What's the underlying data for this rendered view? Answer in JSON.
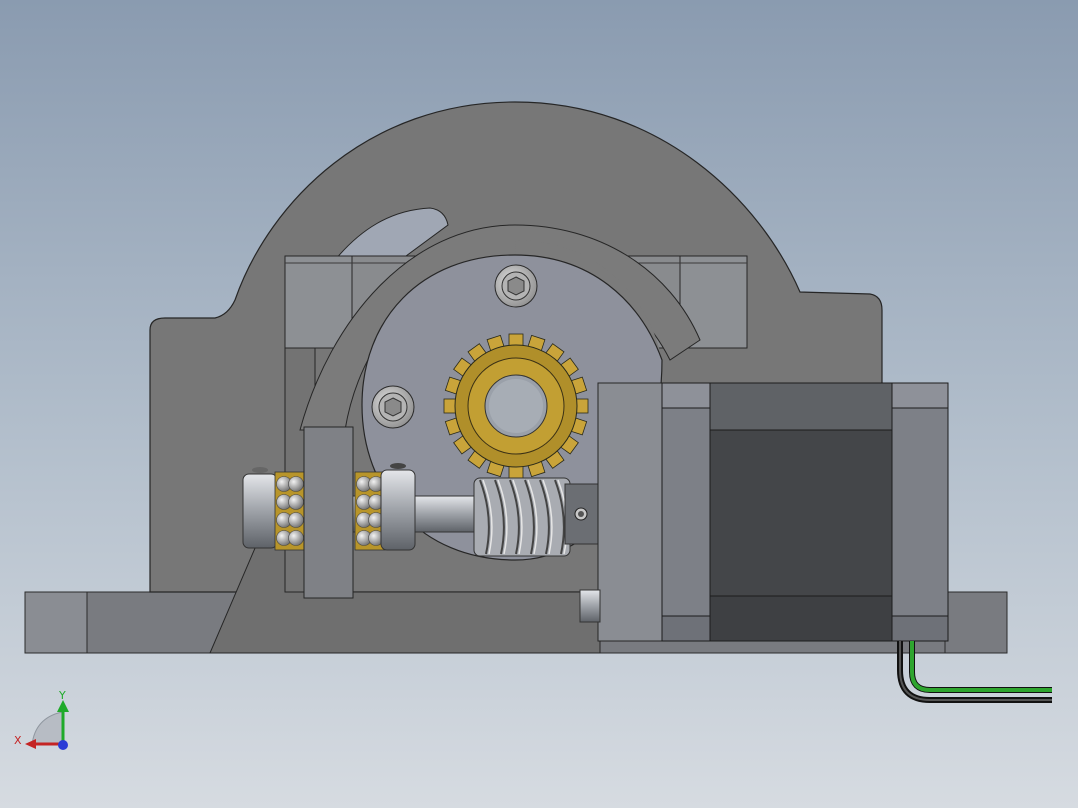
{
  "viewport": {
    "background_top": "#8a9bb0",
    "background_bottom": "#d6dbe1"
  },
  "triad": {
    "y_label": "Y",
    "x_label": "X",
    "y_color": "#1faa2a",
    "x_color": "#c42424",
    "z_color": "#2a3bd6"
  },
  "colors": {
    "housing": "#757575",
    "housing_dark": "#6b6b6b",
    "plate": "#8c8f95",
    "gear": "#b8952a",
    "motor_dark": "#4a4a4a",
    "motor_frame": "#8f939b",
    "cable_green": "#2ea52e",
    "cable_black": "#222222"
  },
  "icons": {
    "triad": "coordinate-triad-icon"
  }
}
